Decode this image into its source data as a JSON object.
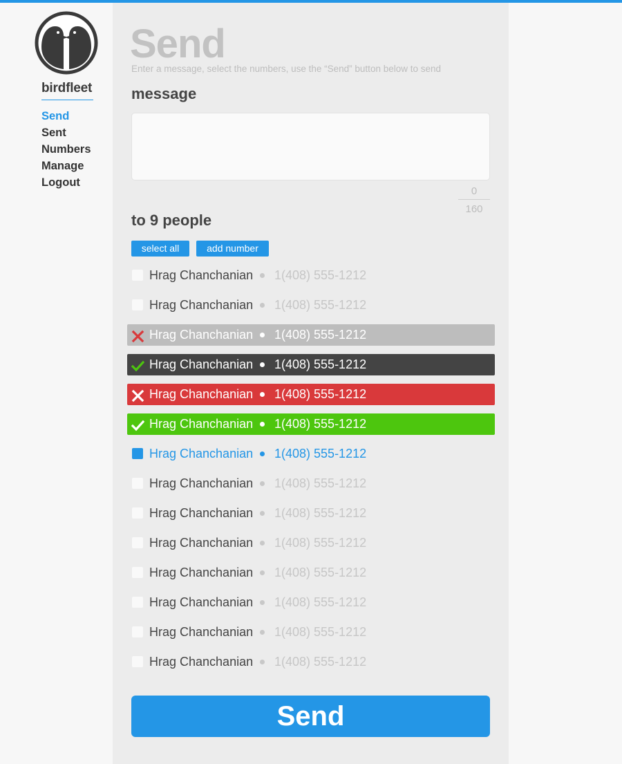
{
  "app": {
    "brand": "birdfleet",
    "accent_color": "#2496e6",
    "logo_icon": "birds-logo-icon"
  },
  "nav": {
    "items": [
      {
        "label": "Send",
        "active": true
      },
      {
        "label": "Sent",
        "active": false
      },
      {
        "label": "Numbers",
        "active": false
      },
      {
        "label": "Manage",
        "active": false
      },
      {
        "label": "Logout",
        "active": false
      }
    ]
  },
  "page": {
    "title": "Send",
    "subtitle": "Enter a message, select the numbers, use the “Send” button below to send"
  },
  "message": {
    "label": "message",
    "value": "",
    "char_count": "0",
    "char_limit": "160"
  },
  "recipients": {
    "label": "to 9 people",
    "select_all_label": "select all",
    "add_number_label": "add number",
    "rows": [
      {
        "name": "Hrag Chanchanian",
        "phone": "1(408) 555-1212",
        "state": "plain",
        "icon": "checkbox-icon"
      },
      {
        "name": "Hrag Chanchanian",
        "phone": "1(408) 555-1212",
        "state": "plain",
        "icon": "checkbox-icon"
      },
      {
        "name": "Hrag Chanchanian",
        "phone": "1(408) 555-1212",
        "state": "failed-gray",
        "icon": "x-icon"
      },
      {
        "name": "Hrag Chanchanian",
        "phone": "1(408) 555-1212",
        "state": "sent-dark",
        "icon": "check-icon"
      },
      {
        "name": "Hrag Chanchanian",
        "phone": "1(408) 555-1212",
        "state": "failed-red",
        "icon": "x-icon"
      },
      {
        "name": "Hrag Chanchanian",
        "phone": "1(408) 555-1212",
        "state": "sent-green",
        "icon": "check-icon"
      },
      {
        "name": "Hrag Chanchanian",
        "phone": "1(408) 555-1212",
        "state": "selected",
        "icon": "checkbox-checked-icon"
      },
      {
        "name": "Hrag Chanchanian",
        "phone": "1(408) 555-1212",
        "state": "plain",
        "icon": "checkbox-icon"
      },
      {
        "name": "Hrag Chanchanian",
        "phone": "1(408) 555-1212",
        "state": "plain",
        "icon": "checkbox-icon"
      },
      {
        "name": "Hrag Chanchanian",
        "phone": "1(408) 555-1212",
        "state": "plain",
        "icon": "checkbox-icon"
      },
      {
        "name": "Hrag Chanchanian",
        "phone": "1(408) 555-1212",
        "state": "plain",
        "icon": "checkbox-icon"
      },
      {
        "name": "Hrag Chanchanian",
        "phone": "1(408) 555-1212",
        "state": "plain",
        "icon": "checkbox-icon"
      },
      {
        "name": "Hrag Chanchanian",
        "phone": "1(408) 555-1212",
        "state": "plain",
        "icon": "checkbox-icon"
      },
      {
        "name": "Hrag Chanchanian",
        "phone": "1(408) 555-1212",
        "state": "plain",
        "icon": "checkbox-icon"
      }
    ]
  },
  "send_button": {
    "label": "Send"
  },
  "status_colors": {
    "failed_gray": "#bdbdbd",
    "sent_dark": "#444444",
    "failed_red": "#d9393b",
    "sent_green": "#4dc60e",
    "selected_blue": "#2496e6"
  }
}
